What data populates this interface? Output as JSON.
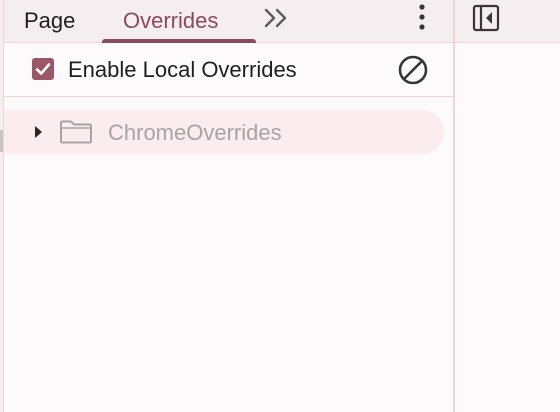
{
  "tabs": [
    {
      "label": "Page",
      "selected": false
    },
    {
      "label": "Overrides",
      "selected": true
    }
  ],
  "toolbar": {
    "enable_local_overrides_label": "Enable Local Overrides",
    "enable_local_overrides_checked": true
  },
  "tree": {
    "items": [
      {
        "label": "ChromeOverrides",
        "expanded": false,
        "icon": "folder-icon"
      }
    ]
  },
  "icons": {
    "more_tabs": "chevron-double-right-icon",
    "menu": "more-vertical-icon",
    "clear": "block-icon",
    "toggle_navigator": "toggle-navigator-icon"
  },
  "colors": {
    "accent": "#8c4a5c",
    "checkbox": "#9a5867",
    "selected_row": "#fbecef",
    "border": "#f0d3d8"
  }
}
